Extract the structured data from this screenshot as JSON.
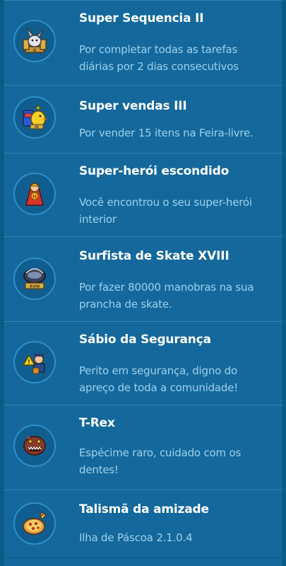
{
  "badges": [
    {
      "title": "Super Sequencia II",
      "description": "Por completar todas as tarefas diárias por 2 dias consecutivos",
      "icon": "rabbit-trophy-icon"
    },
    {
      "title": "Super vendas III",
      "description": "Por vender 15 itens na Feira-livre.",
      "icon": "duck-backpack-icon"
    },
    {
      "title": "Super-herói escondido",
      "description": "Você encontrou o seu super-herói interior",
      "icon": "superhero-cape-icon"
    },
    {
      "title": "Surfista de Skate XVIII",
      "description": "Por fazer 80000 manobras na sua prancha de skate.",
      "icon": "skateboard-badge-icon"
    },
    {
      "title": "Sábio da Segurança",
      "description": "Perito em segurança, digno do apreço de toda a comunidade!",
      "icon": "security-warning-icon"
    },
    {
      "title": "T-Rex",
      "description": "Espécime raro, cuidado com os dentes!",
      "icon": "t-rex-icon"
    },
    {
      "title": "Talismã da amizade",
      "description": "Ilha de Páscoa 2.1.0.4",
      "icon": "pizza-talisman-icon"
    }
  ]
}
